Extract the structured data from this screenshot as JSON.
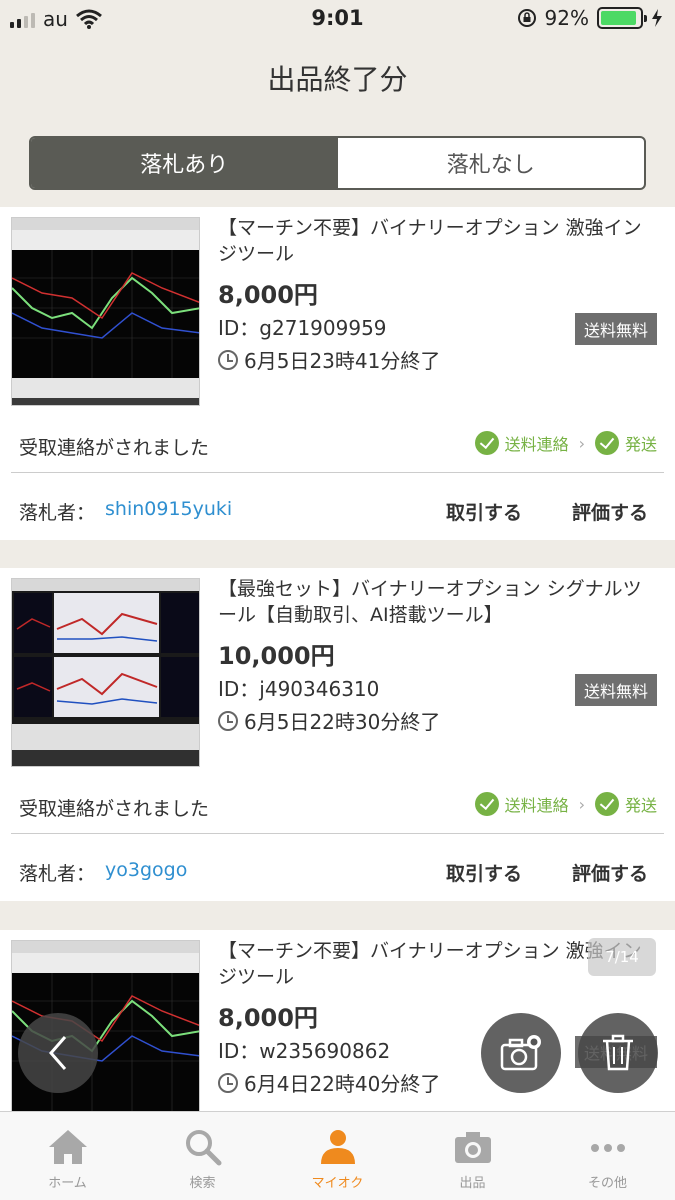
{
  "status_bar": {
    "carrier": "au",
    "time": "9:01",
    "battery": "92%",
    "battery_level": 0.92
  },
  "page_title": "出品終了分",
  "segment": {
    "tabs": [
      "落札あり",
      "落札なし"
    ],
    "selected": 0
  },
  "labels": {
    "ship_badge": "送料無料",
    "status_message": "受取連絡がされました",
    "step_shipping_contact": "送料連絡",
    "step_shipped": "発送",
    "winner_label": "落札者：",
    "deal_button": "取引する",
    "rate_button": "評価する"
  },
  "items": [
    {
      "title": "【マーチン不要】バイナリーオプション 激強インジツール",
      "price": "8,000円",
      "id": "ID：g271909959",
      "end_time": "6月5日23時41分終了",
      "winner": "shin0915yuki"
    },
    {
      "title": "【最強セット】バイナリーオプション シグナルツール【自動取引、AI搭載ツール】",
      "price": "10,000円",
      "id": "ID：j490346310",
      "end_time": "6月5日22時30分終了",
      "winner": "yo3gogo"
    },
    {
      "title": "【マーチン不要】バイナリーオプション 激強インジツール",
      "price": "8,000円",
      "id": "ID：w235690862",
      "end_time": "6月4日22時40分終了"
    }
  ],
  "page_indicator": "7/14",
  "tab_bar": [
    {
      "label": "ホーム",
      "icon": "home-icon"
    },
    {
      "label": "検索",
      "icon": "search-icon"
    },
    {
      "label": "マイオク",
      "icon": "person-icon"
    },
    {
      "label": "出品",
      "icon": "camera-icon"
    },
    {
      "label": "その他",
      "icon": "more-icon"
    }
  ],
  "active_tab": 2,
  "colors": {
    "accent": "#ef8a1e",
    "link": "#2f8fd0",
    "success": "#77b244",
    "segment_active": "#5a5b55"
  }
}
